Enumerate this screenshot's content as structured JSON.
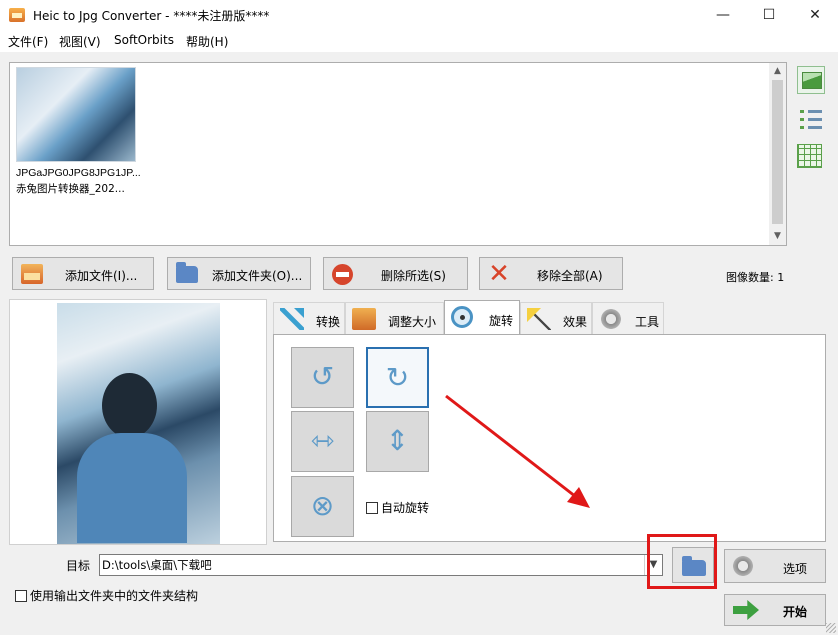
{
  "window": {
    "title": "Heic to Jpg Converter - ****未注册版****",
    "minimize": "—",
    "maximize": "☐",
    "close": "✕"
  },
  "menu": [
    "文件(F)",
    "视图(V)",
    "SoftOrbits",
    "帮助(H)"
  ],
  "files": [
    {
      "name_line1": "JPGaJPG0JPG8JPG1JP...",
      "name_line2": "赤兔图片转换器_202..."
    }
  ],
  "actions": {
    "add_files": "添加文件(I)...",
    "add_folder": "添加文件夹(O)...",
    "remove_selected": "删除所选(S)",
    "remove_all": "移除全部(A)"
  },
  "image_count": "图像数量: 1",
  "tabs": [
    {
      "label": "转换",
      "icon": "convert-icon"
    },
    {
      "label": "调整大小",
      "icon": "resize-icon"
    },
    {
      "label": "旋转",
      "icon": "rotate-icon",
      "active": true
    },
    {
      "label": "效果",
      "icon": "effects-icon"
    },
    {
      "label": "工具",
      "icon": "tools-icon"
    }
  ],
  "rotate": {
    "auto_rotate_label": "自动旋转",
    "auto_rotate_checked": false,
    "selected": "rotate-right"
  },
  "target": {
    "label": "目标",
    "path": "D:\\tools\\桌面\\下载吧"
  },
  "options_label": "选项",
  "start_label": "开始",
  "folder_structure_label": "使用输出文件夹中的文件夹结构",
  "colors": {
    "highlight": "#e01818",
    "accent": "#2a70b0"
  }
}
